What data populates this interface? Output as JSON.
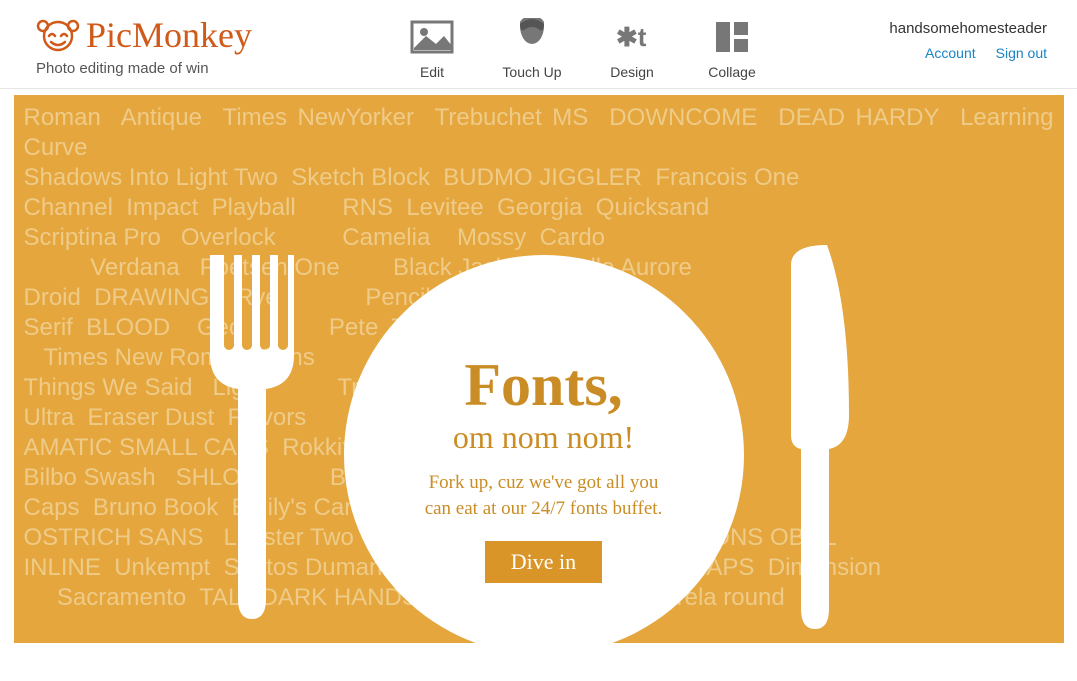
{
  "brand": {
    "name": "PicMonkey",
    "tagline": "Photo editing made of win"
  },
  "nav": {
    "edit": "Edit",
    "touchup": "Touch Up",
    "design": "Design",
    "collage": "Collage"
  },
  "account": {
    "username": "handsomehomesteader",
    "account_link": "Account",
    "signout_link": "Sign out"
  },
  "hero": {
    "title": "Fonts,",
    "subtitle": "om nom nom!",
    "body": "Fork up, cuz we've got all you can eat at our 24/7 fonts buffet.",
    "cta": "Dive in",
    "active_dot": 4,
    "dots": 5
  },
  "font_names": "Roman  Antique  Times NewYorker  Trebuchet MS  DOWNCOME  DEAD HARDY  Learning Curve\nShadows Into Light Two  Sketch Block  BUDMO JIGGLER  Francois One\nChannel  Impact  Playball       RNS  Levitee  Georgia  Quicksand\nScriptina Pro   Overlock          Camelia    Mossy  Cardo\n          Verdana   Poetsen One        Black Jack   La Belle Aurore\nDroid  DRAWING    Rye             Pencil     Great Vibes\nSerif  BLOOD    Geo             Pete  Tahoma   Chelsea Market\n   Times New Roman  Sans           One     Sue Ellen Francisco\nThings We Said   Light           Trick    Marcelle Script\nUltra  Eraser Dust  Flavors         Tony    Special Elite\nAMATIC SMALL CAPS  Rokkit          Arial    Coneria Script\nBilbo Swash   SHLOP           BANGERS    Freshman   Arial Black\nCaps  Bruno Book  Emily's Candy       STAMPETE   Brush-tip  Texe\nOSTRICH SANS   Lobster Two     Eater  Dracula   Stroke  CHARONS OBOL\nINLINE  Unkempt  Santos Dumant  Brushtip Travis  QUENTIN CAPS  Dimension\n     Sacramento  TALL DARK HANDSOME  Coolock Black  varela round"
}
